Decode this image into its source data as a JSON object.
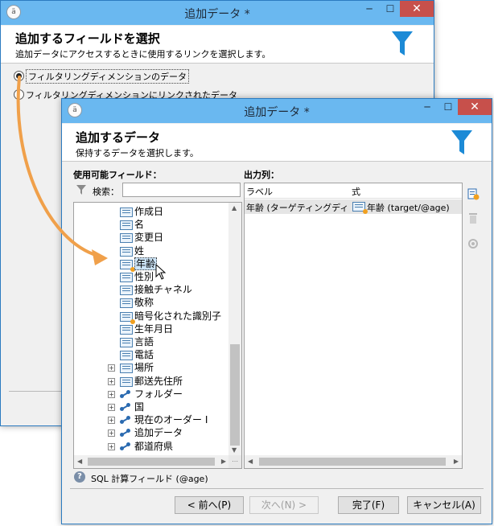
{
  "back_window": {
    "title": "追加データ *",
    "header_title": "追加するフィールドを選択",
    "header_subtitle": "追加データにアクセスするときに使用するリンクを選択します。",
    "options": [
      {
        "label": "フィルタリングディメンションのデータ",
        "selected": true
      },
      {
        "label": "フィルタリングディメンションにリンクされたデータ",
        "selected": false
      }
    ],
    "controls": {
      "minimize": "─",
      "maximize": "☐",
      "close": "✕"
    }
  },
  "front_window": {
    "title": "追加データ *",
    "header_title": "追加するデータ",
    "header_subtitle": "保持するデータを選択します。",
    "controls": {
      "minimize": "─",
      "maximize": "☐",
      "close": "✕"
    },
    "available_fields_label": "使用可能フィールド：",
    "search_label": "検索：",
    "search_value": "",
    "tree_items": [
      {
        "label": "作成日",
        "kind": "field",
        "expand": false,
        "selected": false
      },
      {
        "label": "名",
        "kind": "field",
        "expand": false,
        "selected": false
      },
      {
        "label": "変更日",
        "kind": "field",
        "expand": false,
        "selected": false
      },
      {
        "label": "姓",
        "kind": "field",
        "expand": false,
        "selected": false
      },
      {
        "label": "年齢",
        "kind": "calc",
        "expand": false,
        "selected": true
      },
      {
        "label": "性別",
        "kind": "field",
        "expand": false,
        "selected": false
      },
      {
        "label": "接触チャネル",
        "kind": "field",
        "expand": false,
        "selected": false
      },
      {
        "label": "敬称",
        "kind": "field",
        "expand": false,
        "selected": false
      },
      {
        "label": "暗号化された識別子",
        "kind": "calc",
        "expand": false,
        "selected": false
      },
      {
        "label": "生年月日",
        "kind": "field",
        "expand": false,
        "selected": false
      },
      {
        "label": "言語",
        "kind": "field",
        "expand": false,
        "selected": false
      },
      {
        "label": "電話",
        "kind": "field",
        "expand": false,
        "selected": false
      },
      {
        "label": "場所",
        "kind": "field",
        "expand": true,
        "selected": false
      },
      {
        "label": "郵送先住所",
        "kind": "field",
        "expand": true,
        "selected": false
      },
      {
        "label": "フォルダー",
        "kind": "link",
        "expand": true,
        "selected": false
      },
      {
        "label": "国",
        "kind": "link",
        "expand": true,
        "selected": false
      },
      {
        "label": "現在のオーダー I",
        "kind": "link",
        "expand": true,
        "selected": false
      },
      {
        "label": "追加データ",
        "kind": "link",
        "expand": true,
        "selected": false
      },
      {
        "label": "都道府県",
        "kind": "link",
        "expand": true,
        "selected": false
      }
    ],
    "output_label": "出力列：",
    "output_columns": {
      "label_header": "ラベル",
      "expr_header": "式"
    },
    "output_rows": [
      {
        "label": "年齢 (ターゲティングディ...",
        "expression": "年齢 (target/@age)"
      }
    ],
    "status_text": "SQL 計算フィールド (@age)",
    "buttons": {
      "back": "< 前へ(P)",
      "next": "次へ(N) >",
      "finish": "完了(F)",
      "cancel": "キャンセル(A)"
    },
    "accent_color": "#1c8ad6",
    "titlebar_color": "#6ab8f0",
    "arrow_color": "#f0a04a"
  }
}
